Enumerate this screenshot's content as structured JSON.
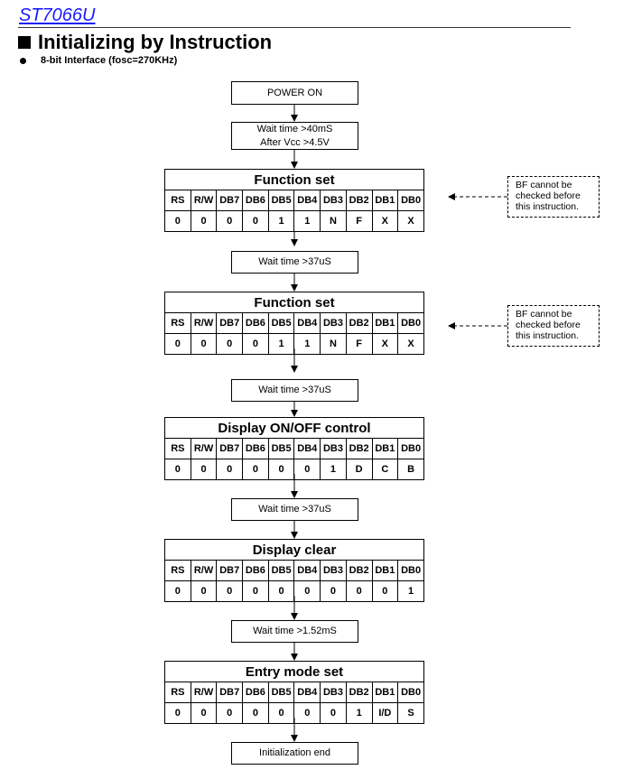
{
  "header": {
    "doc_title": "ST7066U",
    "section_title": "Initializing by Instruction",
    "subtitle": "8-bit Interface (fosc=270KHz)"
  },
  "flow": {
    "power_on": "POWER ON",
    "wait1_line1": "Wait time >40mS",
    "wait1_line2": "After Vcc >4.5V",
    "wait2": "Wait time >37uS",
    "wait3": "Wait time >37uS",
    "wait4": "Wait time >37uS",
    "wait5": "Wait time >1.52mS",
    "end": "Initialization end"
  },
  "columns": [
    "RS",
    "R/W",
    "DB7",
    "DB6",
    "DB5",
    "DB4",
    "DB3",
    "DB2",
    "DB1",
    "DB0"
  ],
  "instructions": [
    {
      "title": "Function set",
      "values": [
        "0",
        "0",
        "0",
        "0",
        "1",
        "1",
        "N",
        "F",
        "X",
        "X"
      ]
    },
    {
      "title": "Function set",
      "values": [
        "0",
        "0",
        "0",
        "0",
        "1",
        "1",
        "N",
        "F",
        "X",
        "X"
      ]
    },
    {
      "title": "Display ON/OFF control",
      "values": [
        "0",
        "0",
        "0",
        "0",
        "0",
        "0",
        "1",
        "D",
        "C",
        "B"
      ]
    },
    {
      "title": "Display clear",
      "values": [
        "0",
        "0",
        "0",
        "0",
        "0",
        "0",
        "0",
        "0",
        "0",
        "1"
      ]
    },
    {
      "title": "Entry mode set",
      "values": [
        "0",
        "0",
        "0",
        "0",
        "0",
        "0",
        "0",
        "1",
        "I/D",
        "S"
      ]
    }
  ],
  "notes": [
    {
      "line1": "BF cannot be",
      "line2": "checked before",
      "line3": "this instruction."
    },
    {
      "line1": "BF cannot be",
      "line2": "checked before",
      "line3": "this instruction."
    }
  ]
}
